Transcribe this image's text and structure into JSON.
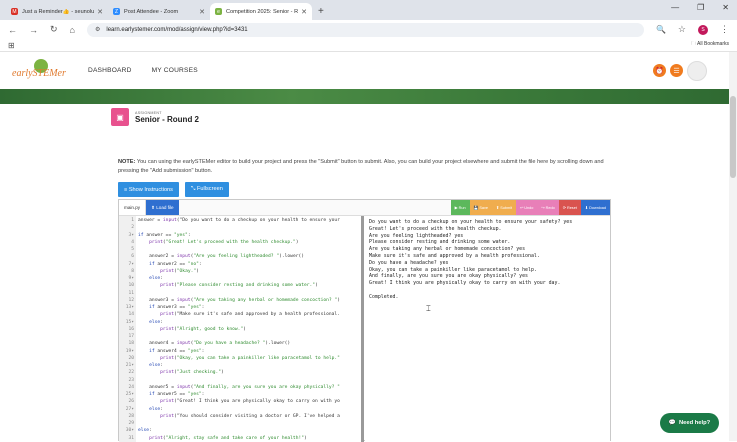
{
  "browser": {
    "tabs": [
      {
        "title": "Just a Reminder👍 - seunoluyi",
        "fav_color": "#d93025",
        "fav_glyph": "M"
      },
      {
        "title": "Post Attendee - Zoom",
        "fav_color": "#2d8cff",
        "fav_glyph": "Z"
      },
      {
        "title": "Competition 2025: Senior - Ro...",
        "fav_color": "#7cb342",
        "fav_glyph": "e"
      }
    ],
    "new_tab": "+",
    "url": "learn.earlystemer.com/mod/assign/view.php?id=3431",
    "profile_letter": "S",
    "all_bookmarks": "All Bookmarks"
  },
  "site": {
    "logo_text": "earlySTEMer",
    "nav": [
      "DASHBOARD",
      "MY COURSES"
    ]
  },
  "assignment": {
    "kicker": "ASSIGNMENT",
    "title": "Senior - Round 2"
  },
  "note": {
    "label": "NOTE:",
    "text": " You can using the earlySTEMer editor to build your project and press the \"Submit\" button to submit. Also, you can build your project elsewhere and submit the file here by scrolling down and pressing the \"Add submission\" button."
  },
  "buttons": {
    "show_instructions": "≡ Show Instructions",
    "fullscreen": "⤡ Fullscreen"
  },
  "editor": {
    "file_tab": "main.py",
    "load_file": "⬆ Load file",
    "tools": [
      {
        "label": "▶ Run",
        "color": "#5cb85c"
      },
      {
        "label": "💾 Save",
        "color": "#f0ad4e"
      },
      {
        "label": "⬆ Submit",
        "color": "#f0ad4e"
      },
      {
        "label": "↩ Undo",
        "color": "#e87fb8"
      },
      {
        "label": "↪ Redo",
        "color": "#e87fb8"
      },
      {
        "label": "⟳ Reset",
        "color": "#d9534f"
      },
      {
        "label": "⬇ Download",
        "color": "#2f6fd0"
      }
    ],
    "code_lines": [
      {
        "n": "1",
        "t": "answer = input(\"Do you want to do a checkup on your health to ensure your"
      },
      {
        "n": "2",
        "t": ""
      },
      {
        "n": "3▾",
        "t": "if answer == \"yes\":"
      },
      {
        "n": "4",
        "t": "    print(\"Great! Let's proceed with the health checkup.\")"
      },
      {
        "n": "5",
        "t": ""
      },
      {
        "n": "6",
        "t": "    answer2 = input(\"Are you feeling lightheaded? \").lower()"
      },
      {
        "n": "7▾",
        "t": "    if answer2 == \"no\":"
      },
      {
        "n": "8",
        "t": "        print(\"Okay.\")"
      },
      {
        "n": "9▾",
        "t": "    else:"
      },
      {
        "n": "10",
        "t": "        print(\"Please consider resting and drinking some water.\")"
      },
      {
        "n": "11",
        "t": ""
      },
      {
        "n": "12",
        "t": "    answer3 = input(\"Are you taking any herbal or homemade concoction? \")"
      },
      {
        "n": "13▾",
        "t": "    if answer3 == \"yes\":"
      },
      {
        "n": "14",
        "t": "        print(\"Make sure it's safe and approved by a health professional."
      },
      {
        "n": "15▾",
        "t": "    else:"
      },
      {
        "n": "16",
        "t": "        print(\"Alright, good to know.\")"
      },
      {
        "n": "17",
        "t": ""
      },
      {
        "n": "18",
        "t": "    answer4 = input(\"Do you have a headache? \").lower()"
      },
      {
        "n": "19▾",
        "t": "    if answer4 == \"yes\":"
      },
      {
        "n": "20",
        "t": "        print(\"Okay, you can take a painkiller like paracetamol to help.\""
      },
      {
        "n": "21▾",
        "t": "    else:"
      },
      {
        "n": "22",
        "t": "        print(\"Just checking.\")"
      },
      {
        "n": "23",
        "t": ""
      },
      {
        "n": "24",
        "t": "    answer5 = input(\"And finally, are you sure you are okay physically? \""
      },
      {
        "n": "25▾",
        "t": "    if answer5 == \"yes\":"
      },
      {
        "n": "26",
        "t": "        print(\"Great! I think you are physically okay to carry on with yo"
      },
      {
        "n": "27▾",
        "t": "    else:"
      },
      {
        "n": "28",
        "t": "        print(\"You should consider visiting a doctor or GP. I've helped a"
      },
      {
        "n": "29",
        "t": ""
      },
      {
        "n": "30▾",
        "t": "else:"
      },
      {
        "n": "31",
        "t": "    print(\"Alright, stay safe and take care of your health!\")"
      }
    ],
    "output_lines": [
      "Do you want to do a checkup on your health to ensure your safety? yes",
      "Great! Let's proceed with the health checkup.",
      "Are you feeling lightheaded? yes",
      "Please consider resting and drinking some water.",
      "Are you taking any herbal or homemade concoction? yes",
      "Make sure it's safe and approved by a health professional.",
      "Do you have a headache? yes",
      "Okay, you can take a painkiller like paracetamol to help.",
      "And finally, are you sure you are okay physically? yes",
      "Great! I think you are physically okay to carry on with your day.",
      "",
      "Completed."
    ]
  },
  "help": {
    "label": "Need help?"
  },
  "colors": {
    "accent_blue": "#2f8fe0",
    "brand_orange": "#f07b1e",
    "band_green": "#3d7b3f",
    "assignment_pink": "#e8518e"
  }
}
